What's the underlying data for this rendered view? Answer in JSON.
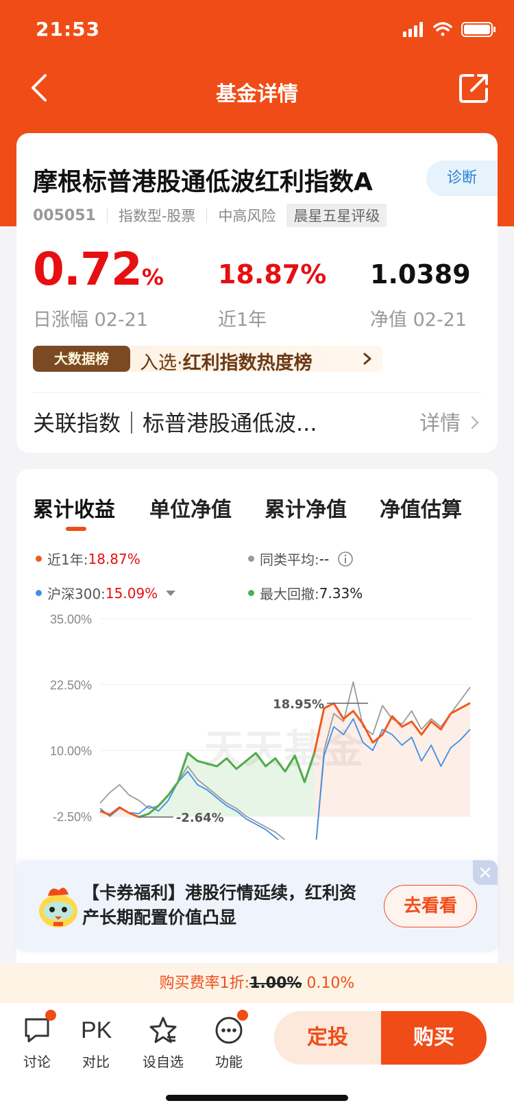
{
  "status": {
    "time": "21:53"
  },
  "nav": {
    "title": "基金详情"
  },
  "fund": {
    "name": "摩根标普港股通低波红利指数A",
    "diagnose_label": "诊断",
    "code": "005051",
    "type": "指数型-股票",
    "risk": "中高风险",
    "rating": "晨星五星评级",
    "daily_change_value": "0.72",
    "daily_change_unit": "%",
    "daily_change_label": "日涨幅 02-21",
    "year_return": "18.87%",
    "year_return_label": "近1年",
    "nav_value": "1.0389",
    "nav_label": "净值 02-21",
    "rank_badge": "大数据榜",
    "rank_prefix": "入选·",
    "rank_text": "红利指数热度榜",
    "related_index": "关联指数｜标普港股通低波...",
    "related_detail": "详情"
  },
  "tabs": [
    "累计收益",
    "单位净值",
    "累计净值",
    "净值估算"
  ],
  "legend": {
    "year_label": "近1年:",
    "year_value": "18.87%",
    "peer_label": "同类平均:",
    "peer_value": "--",
    "hs300_label": "沪深300:",
    "hs300_value": "15.09%",
    "drawdown_label": "最大回撤:",
    "drawdown_value": "7.33%"
  },
  "colors": {
    "brand": "#f04c17",
    "fund_line": "#f05a1e",
    "hs300_line": "#3d8fe8",
    "peer_line": "#9a9a9a",
    "drawdown_line": "#4caf50",
    "up": "#e60f12"
  },
  "chart_data": {
    "type": "line",
    "y_ticks": [
      "35.00%",
      "22.50%",
      "10.00%",
      "-2.50%"
    ],
    "ylim": [
      -2.5,
      35
    ],
    "watermark": "天天基金",
    "annotations": {
      "high": "18.95%",
      "low": "-2.64%"
    },
    "series": [
      {
        "name": "近1年",
        "values": [
          -1.5,
          -2.2,
          -0.8,
          -1.9,
          -2.64,
          -2.0,
          -0.5,
          1.5,
          4.0,
          9.5,
          8.0,
          7.5,
          7.0,
          8.5,
          6.5,
          8.0,
          9.5,
          7.0,
          8.5,
          6.0,
          9.0,
          4.0,
          9.5,
          18.0,
          18.95,
          16.0,
          17.5,
          15.0,
          11.5,
          13.0,
          16.5,
          14.5,
          15.5,
          13.0,
          15.5,
          14.0,
          17.0,
          18.0,
          19.0
        ]
      },
      {
        "name": "沪深300",
        "values": [
          -1.0,
          -2.5,
          -1.0,
          -1.8,
          -2.0,
          -0.5,
          -1.5,
          0.5,
          4.0,
          6.0,
          3.5,
          2.5,
          1.0,
          -0.5,
          -1.5,
          -3.0,
          -4.0,
          -5.0,
          -6.5,
          -8.0,
          -9.0,
          -10.5,
          -11.0,
          9.0,
          14.5,
          13.0,
          16.0,
          11.5,
          10.0,
          14.0,
          13.0,
          11.0,
          12.5,
          8.0,
          11.0,
          7.0,
          10.5,
          12.0,
          14.0
        ]
      },
      {
        "name": "同类平均",
        "values": [
          0.0,
          2.0,
          3.5,
          1.5,
          0.5,
          -1.0,
          -0.5,
          1.5,
          4.0,
          7.0,
          4.5,
          3.0,
          1.5,
          0.0,
          -1.0,
          -2.5,
          -3.5,
          -4.5,
          -5.5,
          -7.0,
          -8.5,
          -10.0,
          -11.5,
          10.0,
          17.0,
          15.5,
          23.0,
          14.5,
          13.0,
          18.5,
          16.0,
          15.0,
          17.5,
          14.0,
          16.0,
          14.5,
          17.0,
          19.5,
          22.0
        ]
      }
    ]
  },
  "promo": {
    "text": "【卡券福利】港股行情延续，红利资产长期配置价值凸显",
    "button": "去看看"
  },
  "fee": {
    "prefix": "购买费率1折:",
    "original": "1.00%",
    "discounted": "0.10%"
  },
  "bottom_bar": {
    "discuss": "讨论",
    "compare": "对比",
    "compare_icon": "PK",
    "watchlist": "设自选",
    "functions": "功能",
    "auto_invest": "定投",
    "buy": "购买"
  }
}
